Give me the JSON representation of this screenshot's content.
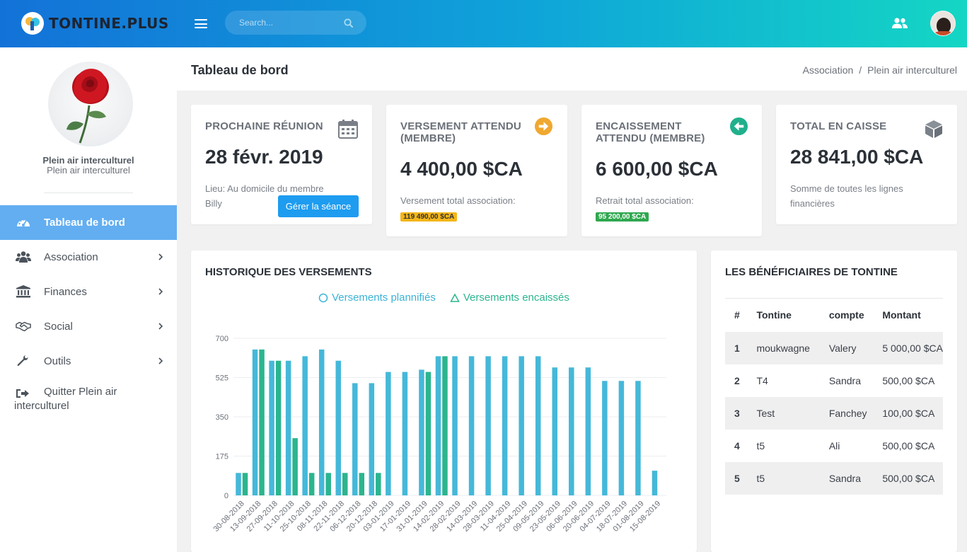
{
  "app": {
    "brand": "TONTINE.PLUS"
  },
  "search": {
    "placeholder": "Search..."
  },
  "sidebar": {
    "org_name": "Plein air interculturel",
    "org_subtitle": "Plein air interculturel",
    "items": [
      {
        "label": "Tableau de bord",
        "icon": "dashboard-icon"
      },
      {
        "label": "Association",
        "icon": "users-icon"
      },
      {
        "label": "Finances",
        "icon": "bank-icon"
      },
      {
        "label": "Social",
        "icon": "handshake-icon"
      },
      {
        "label": "Outils",
        "icon": "wrench-icon"
      }
    ],
    "quit_line1": "Quitter Plein air",
    "quit_line2": "interculturel"
  },
  "page": {
    "title": "Tableau de bord",
    "breadcrumb": [
      "Association",
      "/",
      "Plein air interculturel"
    ]
  },
  "cards": {
    "meeting": {
      "label": "PROCHAINE RÉUNION",
      "value": "28 févr. 2019",
      "sub1": "Lieu: Au domicile du membre",
      "sub2": "Billy",
      "button": "Gérer la séance"
    },
    "expected_payment": {
      "label1": "VERSEMENT ATTENDU",
      "label2": "(MEMBRE)",
      "value": "4 400,00 $CA",
      "sub": "Versement total association:",
      "pill": "119 490,00 $CA",
      "pill_color": "#f4b619"
    },
    "expected_cash": {
      "label1": "ENCAISSEMENT",
      "label2": "ATTENDU (MEMBRE)",
      "value": "6 600,00 $CA",
      "sub": "Retrait total association:",
      "pill": "95 200,00 $CA",
      "pill_color": "#2fa84f"
    },
    "total": {
      "label": "TOTAL EN CAISSE",
      "value": "28 841,00 $CA",
      "sub1": "Somme de toutes les lignes",
      "sub2": "financières"
    }
  },
  "chart_section": {
    "title": "HISTORIQUE DES VERSEMENTS"
  },
  "chart_data": {
    "type": "bar",
    "xlabel": "",
    "ylabel": "",
    "ylim": [
      0,
      700
    ],
    "yticks": [
      0,
      175,
      350,
      525,
      700
    ],
    "grid": true,
    "legend_position": "top-center",
    "categories": [
      "30-08-2018",
      "13-09-2018",
      "27-09-2018",
      "11-10-2018",
      "25-10-2018",
      "08-11-2018",
      "22-11-2018",
      "06-12-2018",
      "20-12-2018",
      "03-01-2019",
      "17-01-2019",
      "31-01-2019",
      "14-02-2019",
      "28-02-2019",
      "14-03-2019",
      "28-03-2019",
      "11-04-2019",
      "25-04-2019",
      "09-05-2019",
      "23-05-2019",
      "06-06-2019",
      "20-06-2019",
      "04-07-2019",
      "18-07-2019",
      "01-08-2019",
      "15-08-2019"
    ],
    "series": [
      {
        "name": "Versements plannifiés",
        "color": "#45b8d9",
        "values": [
          100,
          650,
          600,
          600,
          620,
          650,
          600,
          500,
          500,
          550,
          550,
          560,
          620,
          620,
          620,
          620,
          620,
          620,
          620,
          570,
          570,
          570,
          510,
          510,
          510,
          110
        ]
      },
      {
        "name": "Versements encaissés",
        "color": "#2bb58e",
        "values": [
          100,
          650,
          600,
          255,
          100,
          100,
          100,
          100,
          100,
          0,
          0,
          550,
          620,
          0,
          0,
          0,
          0,
          0,
          0,
          0,
          0,
          0,
          0,
          0,
          0,
          0
        ]
      }
    ]
  },
  "beneficiaries": {
    "title": "LES BÉNÉFICIAIRES DE TONTINE",
    "headers": [
      "#",
      "Tontine",
      "compte",
      "Montant"
    ],
    "rows": [
      [
        "1",
        "moukwagne",
        "Valery",
        "5 000,00 $CA"
      ],
      [
        "2",
        "T4",
        "Sandra",
        "500,00 $CA"
      ],
      [
        "3",
        "Test",
        "Fanchey",
        "100,00 $CA"
      ],
      [
        "4",
        "t5",
        "Ali",
        "500,00 $CA"
      ],
      [
        "5",
        "t5",
        "Sandra",
        "500,00 $CA"
      ]
    ]
  }
}
